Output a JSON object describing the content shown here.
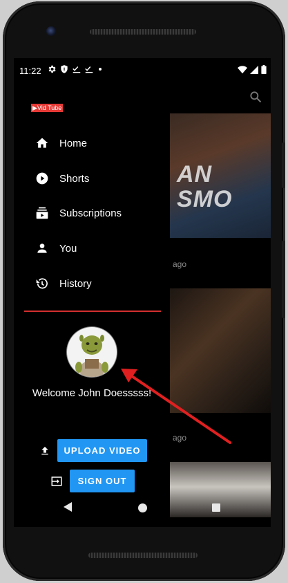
{
  "status_bar": {
    "time": "11:22",
    "left_icons": [
      "gear-icon",
      "shield-icon",
      "check-icon",
      "check-icon",
      "dot-icon"
    ],
    "right_icons": [
      "wifi-icon",
      "signal-icon",
      "battery-icon"
    ]
  },
  "app": {
    "logo_text": "▶Vid Tube",
    "logo_color": "#e53935"
  },
  "drawer": {
    "menu": [
      {
        "label": "Home",
        "icon": "home-icon"
      },
      {
        "label": "Shorts",
        "icon": "play-circle-icon"
      },
      {
        "label": "Subscriptions",
        "icon": "subscriptions-icon"
      },
      {
        "label": "You",
        "icon": "person-icon"
      },
      {
        "label": "History",
        "icon": "history-icon"
      }
    ],
    "divider_color": "#d32f2f",
    "welcome_text": "Welcome John Doesssss!",
    "upload_label": "UPLOAD VIDEO",
    "signout_label": "SIGN OUT",
    "button_color": "#2196f3"
  },
  "background_feed": {
    "thumb1_text_line1": "AN",
    "thumb1_text_line2": "SMO",
    "ago_1": "ago",
    "ago_2": "ago"
  },
  "annotation": {
    "arrow_color": "#e02020"
  }
}
